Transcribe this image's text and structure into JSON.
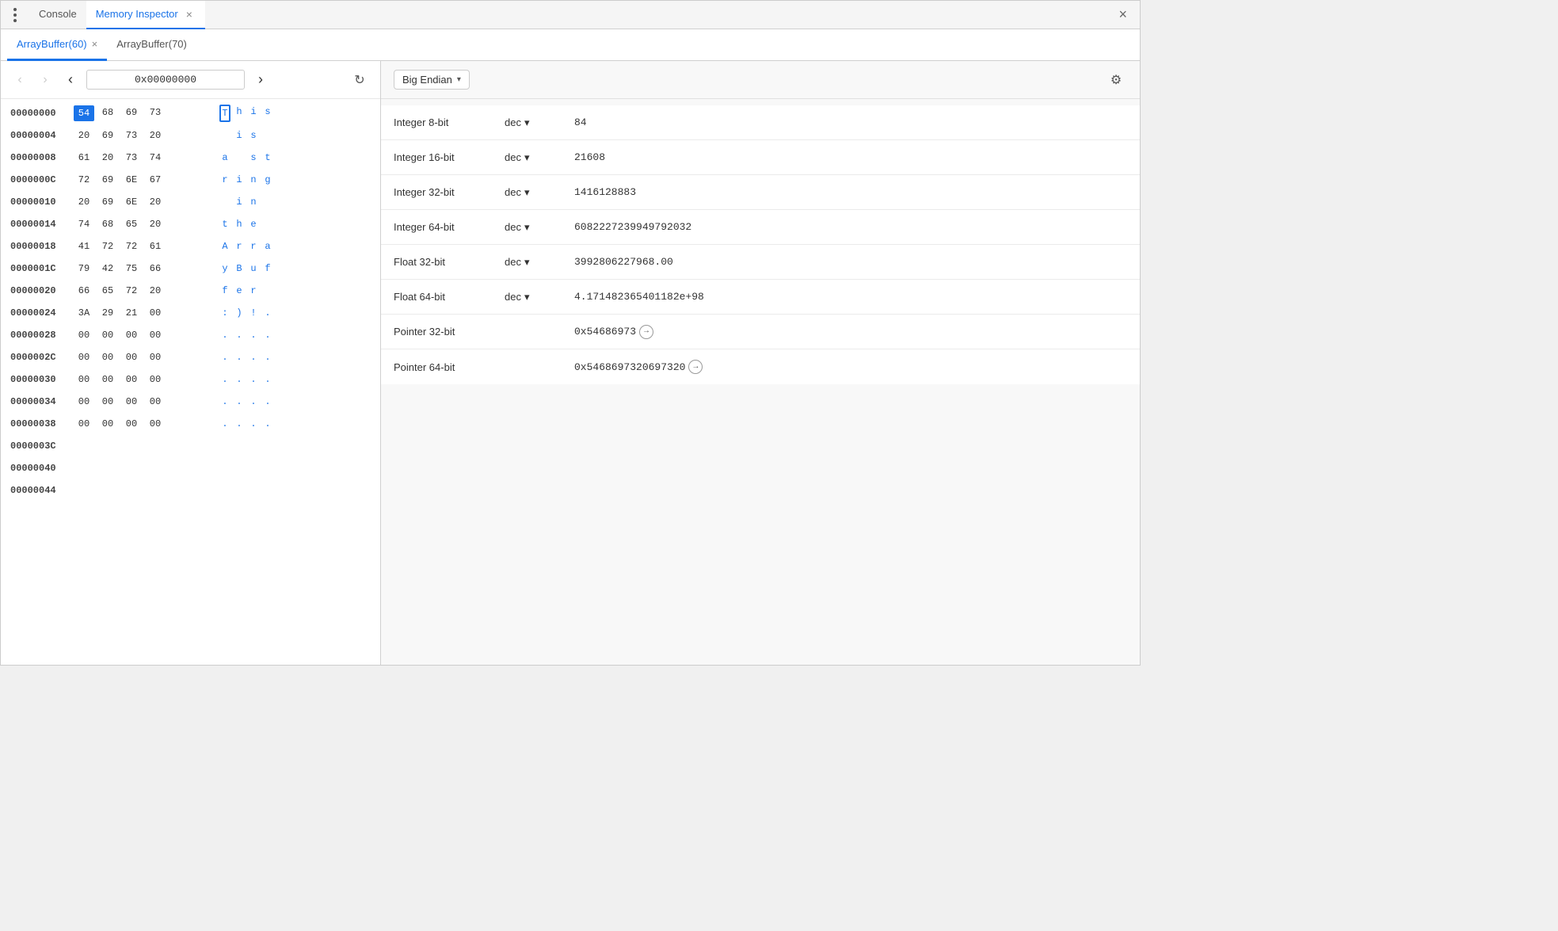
{
  "window": {
    "title": "Memory Inspector"
  },
  "top_tabs": [
    {
      "label": "Console",
      "active": false,
      "closeable": false
    },
    {
      "label": "Memory Inspector",
      "active": true,
      "closeable": true
    }
  ],
  "buffer_tabs": [
    {
      "label": "ArrayBuffer(60)",
      "active": true,
      "closeable": true
    },
    {
      "label": "ArrayBuffer(70)",
      "active": false,
      "closeable": false
    }
  ],
  "nav": {
    "back_label": "◀",
    "forward_label": "▶",
    "address": "0x00000000",
    "refresh_label": "↻",
    "chevron_left": "‹",
    "chevron_right": "›"
  },
  "memory_rows": [
    {
      "address": "00000000",
      "hex": [
        "54",
        "68",
        "69",
        "73"
      ],
      "hex_selected": [
        0
      ],
      "hex_cursor": [],
      "ascii": [
        "T",
        "h",
        "i",
        "s"
      ],
      "ascii_cursor": [
        0
      ]
    },
    {
      "address": "00000004",
      "hex": [
        "20",
        "69",
        "73",
        "20"
      ],
      "hex_selected": [],
      "hex_cursor": [],
      "ascii": [
        " ",
        "i",
        "s",
        " "
      ],
      "ascii_cursor": []
    },
    {
      "address": "00000008",
      "hex": [
        "61",
        "20",
        "73",
        "74"
      ],
      "hex_selected": [],
      "hex_cursor": [],
      "ascii": [
        "a",
        " ",
        "s",
        "t"
      ],
      "ascii_cursor": []
    },
    {
      "address": "0000000C",
      "hex": [
        "72",
        "69",
        "6E",
        "67"
      ],
      "hex_selected": [],
      "hex_cursor": [],
      "ascii": [
        "r",
        "i",
        "n",
        "g"
      ],
      "ascii_cursor": []
    },
    {
      "address": "00000010",
      "hex": [
        "20",
        "69",
        "6E",
        "20"
      ],
      "hex_selected": [],
      "hex_cursor": [],
      "ascii": [
        " ",
        "i",
        "n",
        " "
      ],
      "ascii_cursor": []
    },
    {
      "address": "00000014",
      "hex": [
        "74",
        "68",
        "65",
        "20"
      ],
      "hex_selected": [],
      "hex_cursor": [],
      "ascii": [
        "t",
        "h",
        "e",
        " "
      ],
      "ascii_cursor": []
    },
    {
      "address": "00000018",
      "hex": [
        "41",
        "72",
        "72",
        "61"
      ],
      "hex_selected": [],
      "hex_cursor": [],
      "ascii": [
        "A",
        "r",
        "r",
        "a"
      ],
      "ascii_cursor": []
    },
    {
      "address": "0000001C",
      "hex": [
        "79",
        "42",
        "75",
        "66"
      ],
      "hex_selected": [],
      "hex_cursor": [],
      "ascii": [
        "y",
        "B",
        "u",
        "f"
      ],
      "ascii_cursor": []
    },
    {
      "address": "00000020",
      "hex": [
        "66",
        "65",
        "72",
        "20"
      ],
      "hex_selected": [],
      "hex_cursor": [],
      "ascii": [
        "f",
        "e",
        "r",
        " "
      ],
      "ascii_cursor": []
    },
    {
      "address": "00000024",
      "hex": [
        "3A",
        "29",
        "21",
        "00"
      ],
      "hex_selected": [],
      "hex_cursor": [],
      "ascii": [
        ":",
        ")",
        "!",
        "."
      ],
      "ascii_cursor": []
    },
    {
      "address": "00000028",
      "hex": [
        "00",
        "00",
        "00",
        "00"
      ],
      "hex_selected": [],
      "hex_cursor": [],
      "ascii": [
        ".",
        ".",
        ".",
        "."
      ],
      "ascii_cursor": []
    },
    {
      "address": "0000002C",
      "hex": [
        "00",
        "00",
        "00",
        "00"
      ],
      "hex_selected": [],
      "hex_cursor": [],
      "ascii": [
        ".",
        ".",
        ".",
        "."
      ],
      "ascii_cursor": []
    },
    {
      "address": "00000030",
      "hex": [
        "00",
        "00",
        "00",
        "00"
      ],
      "hex_selected": [],
      "hex_cursor": [],
      "ascii": [
        ".",
        ".",
        ".",
        "."
      ],
      "ascii_cursor": []
    },
    {
      "address": "00000034",
      "hex": [
        "00",
        "00",
        "00",
        "00"
      ],
      "hex_selected": [],
      "hex_cursor": [],
      "ascii": [
        ".",
        ".",
        ".",
        "."
      ],
      "ascii_cursor": []
    },
    {
      "address": "00000038",
      "hex": [
        "00",
        "00",
        "00",
        "00"
      ],
      "hex_selected": [],
      "hex_cursor": [],
      "ascii": [
        ".",
        ".",
        ".",
        "."
      ],
      "ascii_cursor": []
    },
    {
      "address": "0000003C",
      "hex": [],
      "hex_selected": [],
      "hex_cursor": [],
      "ascii": [],
      "ascii_cursor": []
    },
    {
      "address": "00000040",
      "hex": [],
      "hex_selected": [],
      "hex_cursor": [],
      "ascii": [],
      "ascii_cursor": []
    },
    {
      "address": "00000044",
      "hex": [],
      "hex_selected": [],
      "hex_cursor": [],
      "ascii": [],
      "ascii_cursor": []
    }
  ],
  "inspector": {
    "endian": "Big Endian",
    "rows": [
      {
        "type": "Integer 8-bit",
        "format": "dec",
        "has_format": true,
        "value": "84",
        "is_pointer": false
      },
      {
        "type": "Integer 16-bit",
        "format": "dec",
        "has_format": true,
        "value": "21608",
        "is_pointer": false
      },
      {
        "type": "Integer 32-bit",
        "format": "dec",
        "has_format": true,
        "value": "1416128883",
        "is_pointer": false
      },
      {
        "type": "Integer 64-bit",
        "format": "dec",
        "has_format": true,
        "value": "6082227239949792032",
        "is_pointer": false
      },
      {
        "type": "Float 32-bit",
        "format": "dec",
        "has_format": true,
        "value": "3992806227968.00",
        "is_pointer": false
      },
      {
        "type": "Float 64-bit",
        "format": "dec",
        "has_format": true,
        "value": "4.171482365401182e+98",
        "is_pointer": false
      },
      {
        "type": "Pointer 32-bit",
        "format": "",
        "has_format": false,
        "value": "0x54686973",
        "is_pointer": true
      },
      {
        "type": "Pointer 64-bit",
        "format": "",
        "has_format": false,
        "value": "0x5468697320697320",
        "is_pointer": true
      }
    ]
  },
  "icons": {
    "three_dots": "⋮",
    "close": "×",
    "back": "‹",
    "forward": "›",
    "refresh": "↻",
    "settings": "⚙",
    "chevron_down": "▾",
    "pointer_jump": "→"
  }
}
